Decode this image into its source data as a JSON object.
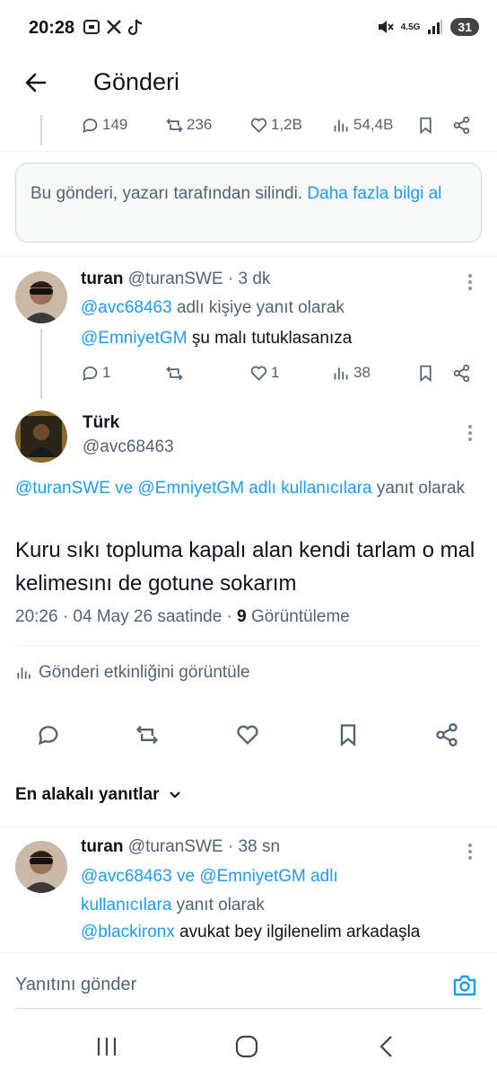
{
  "status": {
    "time": "20:28",
    "network": "4.5G",
    "battery": "31"
  },
  "header": {
    "title": "Gönderi"
  },
  "prev_actions": {
    "replies": "149",
    "reposts": "236",
    "likes": "1,2B",
    "views": "54,4B"
  },
  "deleted_notice": {
    "text": "Bu gönderi, yazarı tarafından silindi.",
    "link": "Daha fazla bilgi al"
  },
  "reply1": {
    "name": "turan",
    "handle": "@turanSWE",
    "time": "· 3 dk",
    "reply_to_handle": "@avc68463",
    "reply_to_suffix": "adlı kişiye yanıt olarak",
    "mention": "@EmniyetGM",
    "text": "şu malı tutuklasanıza",
    "replies": "1",
    "likes": "1",
    "views": "38"
  },
  "main": {
    "name": "Türk",
    "handle": "@avc68463",
    "reply_to_links": "@turanSWE ve @EmniyetGM adlı kullanıcılara",
    "reply_to_suffix": "yanıt olarak",
    "text": "Kuru sıkı topluma kapalı alan kendi tarlam o mal kelimesını de gotune sokarım",
    "timestamp": "20:26 · 04 May 26 saatinde ·",
    "views_count": "9",
    "views_label": "Görüntüleme",
    "activity_label": "Gönderi etkinliğini görüntüle"
  },
  "sort": {
    "label": "En alakalı yanıtlar"
  },
  "reply2": {
    "name": "turan",
    "handle": "@turanSWE",
    "time": "· 38 sn",
    "reply_to_line1": "@avc68463 ve @EmniyetGM adlı",
    "reply_to_line2_link": "kullanıcılara",
    "reply_to_line2_suffix": "yanıt olarak",
    "mention": "@blackironx",
    "text": "avukat bey ilgilenelim arkadaşla"
  },
  "composer": {
    "placeholder": "Yanıtını gönder"
  },
  "colors": {
    "accent": "#1d9bf0",
    "text": "#0f1419",
    "muted": "#536471"
  }
}
